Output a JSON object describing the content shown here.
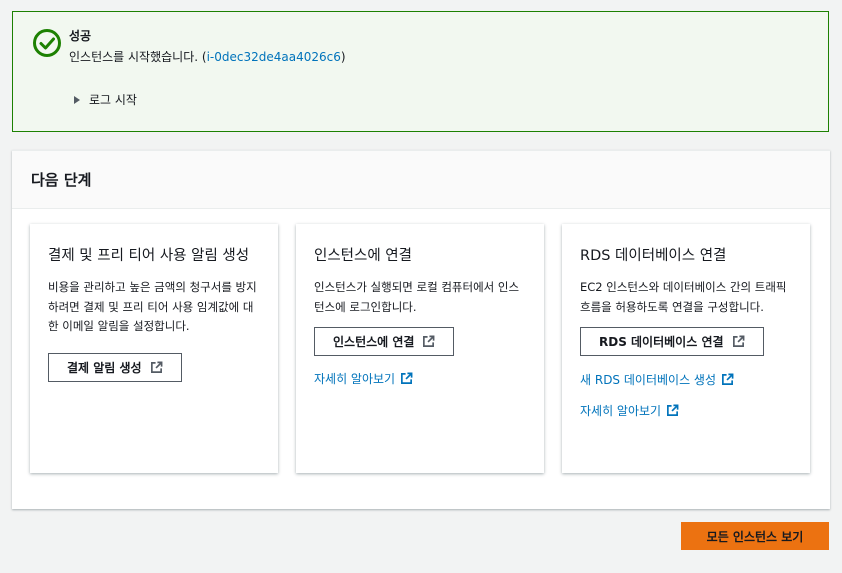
{
  "flash": {
    "title": "성공",
    "message_prefix": "인스턴스를 시작했습니다. (",
    "instance_id": "i-0dec32de4aa4026c6",
    "message_suffix": ")",
    "log_toggle_label": "로그 시작"
  },
  "next_steps": {
    "title": "다음 단계",
    "cards": [
      {
        "title": "결제 및 프리 티어 사용 알림 생성",
        "description": "비용을 관리하고 높은 금액의 청구서를 방지하려면 결제 및 프리 티어 사용 임계값에 대한 이메일 알림을 설정합니다.",
        "button_label": "결제 알림 생성"
      },
      {
        "title": "인스턴스에 연결",
        "description": "인스턴스가 실행되면 로컬 컴퓨터에서 인스턴스에 로그인합니다.",
        "button_label": "인스턴스에 연결",
        "link_label": "자세히 알아보기"
      },
      {
        "title": "RDS 데이터베이스 연결",
        "description": "EC2 인스턴스와 데이터베이스 간의 트래픽 흐름을 허용하도록 연결을 구성합니다.",
        "button_label": "RDS 데이터베이스 연결",
        "link1_label": "새 RDS 데이터베이스 생성",
        "link2_label": "자세히 알아보기"
      }
    ]
  },
  "footer": {
    "primary_button_label": "모든 인스턴스 보기"
  },
  "colors": {
    "success": "#1d8102",
    "link": "#0073bb",
    "primary": "#ec7211"
  },
  "icons": {
    "success": "check-circle-icon",
    "external": "external-link-icon",
    "caret": "caret-right-icon"
  }
}
